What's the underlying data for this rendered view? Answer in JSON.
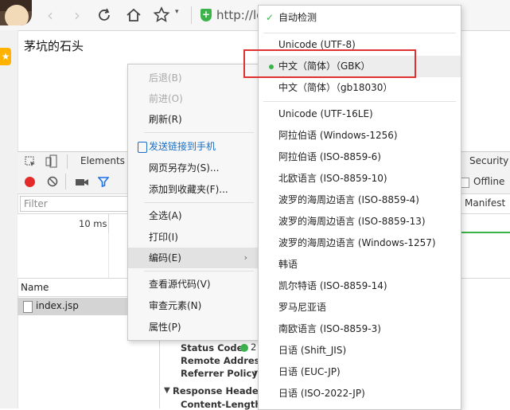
{
  "toolbar": {
    "url_text": "http://lo",
    "avatar": "user-avatar",
    "icons": [
      "back-icon",
      "forward-icon",
      "refresh-icon",
      "home-icon",
      "star-icon",
      "chevron-down-icon",
      "shield-icon"
    ]
  },
  "page": {
    "title": "茅坑的石头"
  },
  "devtools": {
    "tabs": {
      "elements": "Elements",
      "security": "Security"
    },
    "offline_label": "Offline",
    "manifest_label": "Manifest",
    "filter_placeholder": "Filter",
    "timeline_label": "10 ms",
    "name_header": "Name",
    "file": "index.jsp",
    "details": {
      "status_code": "Status Code:",
      "remote_address": "Remote Address:",
      "referrer_policy": "Referrer Policy:",
      "response_headers": "Response Headers",
      "content_length": "Content-Length:"
    },
    "colors": {
      "record": "#e32b2b",
      "filter_icon": "#1a73e8",
      "ok": "#3cb34a"
    }
  },
  "context_menu": {
    "back": "后退(B)",
    "forward": "前进(O)",
    "refresh": "刷新(R)",
    "send_to_phone": "发送链接到手机",
    "save_as": "网页另存为(S)...",
    "add_favorite": "添加到收藏夹(F)...",
    "select_all": "全选(A)",
    "print": "打印(I)",
    "encoding": "编码(E)",
    "view_source": "查看源代码(V)",
    "inspect": "审查元素(N)",
    "properties": "属性(P)"
  },
  "encoding_menu": {
    "auto_detect": "自动检测",
    "items": [
      "Unicode (UTF-8)",
      "中文（简体）（GBK）",
      "中文（简体）（gb18030）",
      "Unicode (UTF-16LE)",
      "阿拉伯语 (Windows-1256)",
      "阿拉伯语 (ISO-8859-6)",
      "北欧语言 (ISO-8859-10)",
      "波罗的海周边语言 (ISO-8859-4)",
      "波罗的海周边语言 (ISO-8859-13)",
      "波罗的海周边语言 (Windows-1257)",
      "韩语",
      "凯尔特语 (ISO-8859-14)",
      "罗马尼亚语",
      "南欧语言 (ISO-8859-3)",
      "日语 (Shift_JIS)",
      "日语 (EUC-JP)",
      "日语 (ISO-2022-JP)"
    ],
    "highlight_color": "#e03131"
  }
}
